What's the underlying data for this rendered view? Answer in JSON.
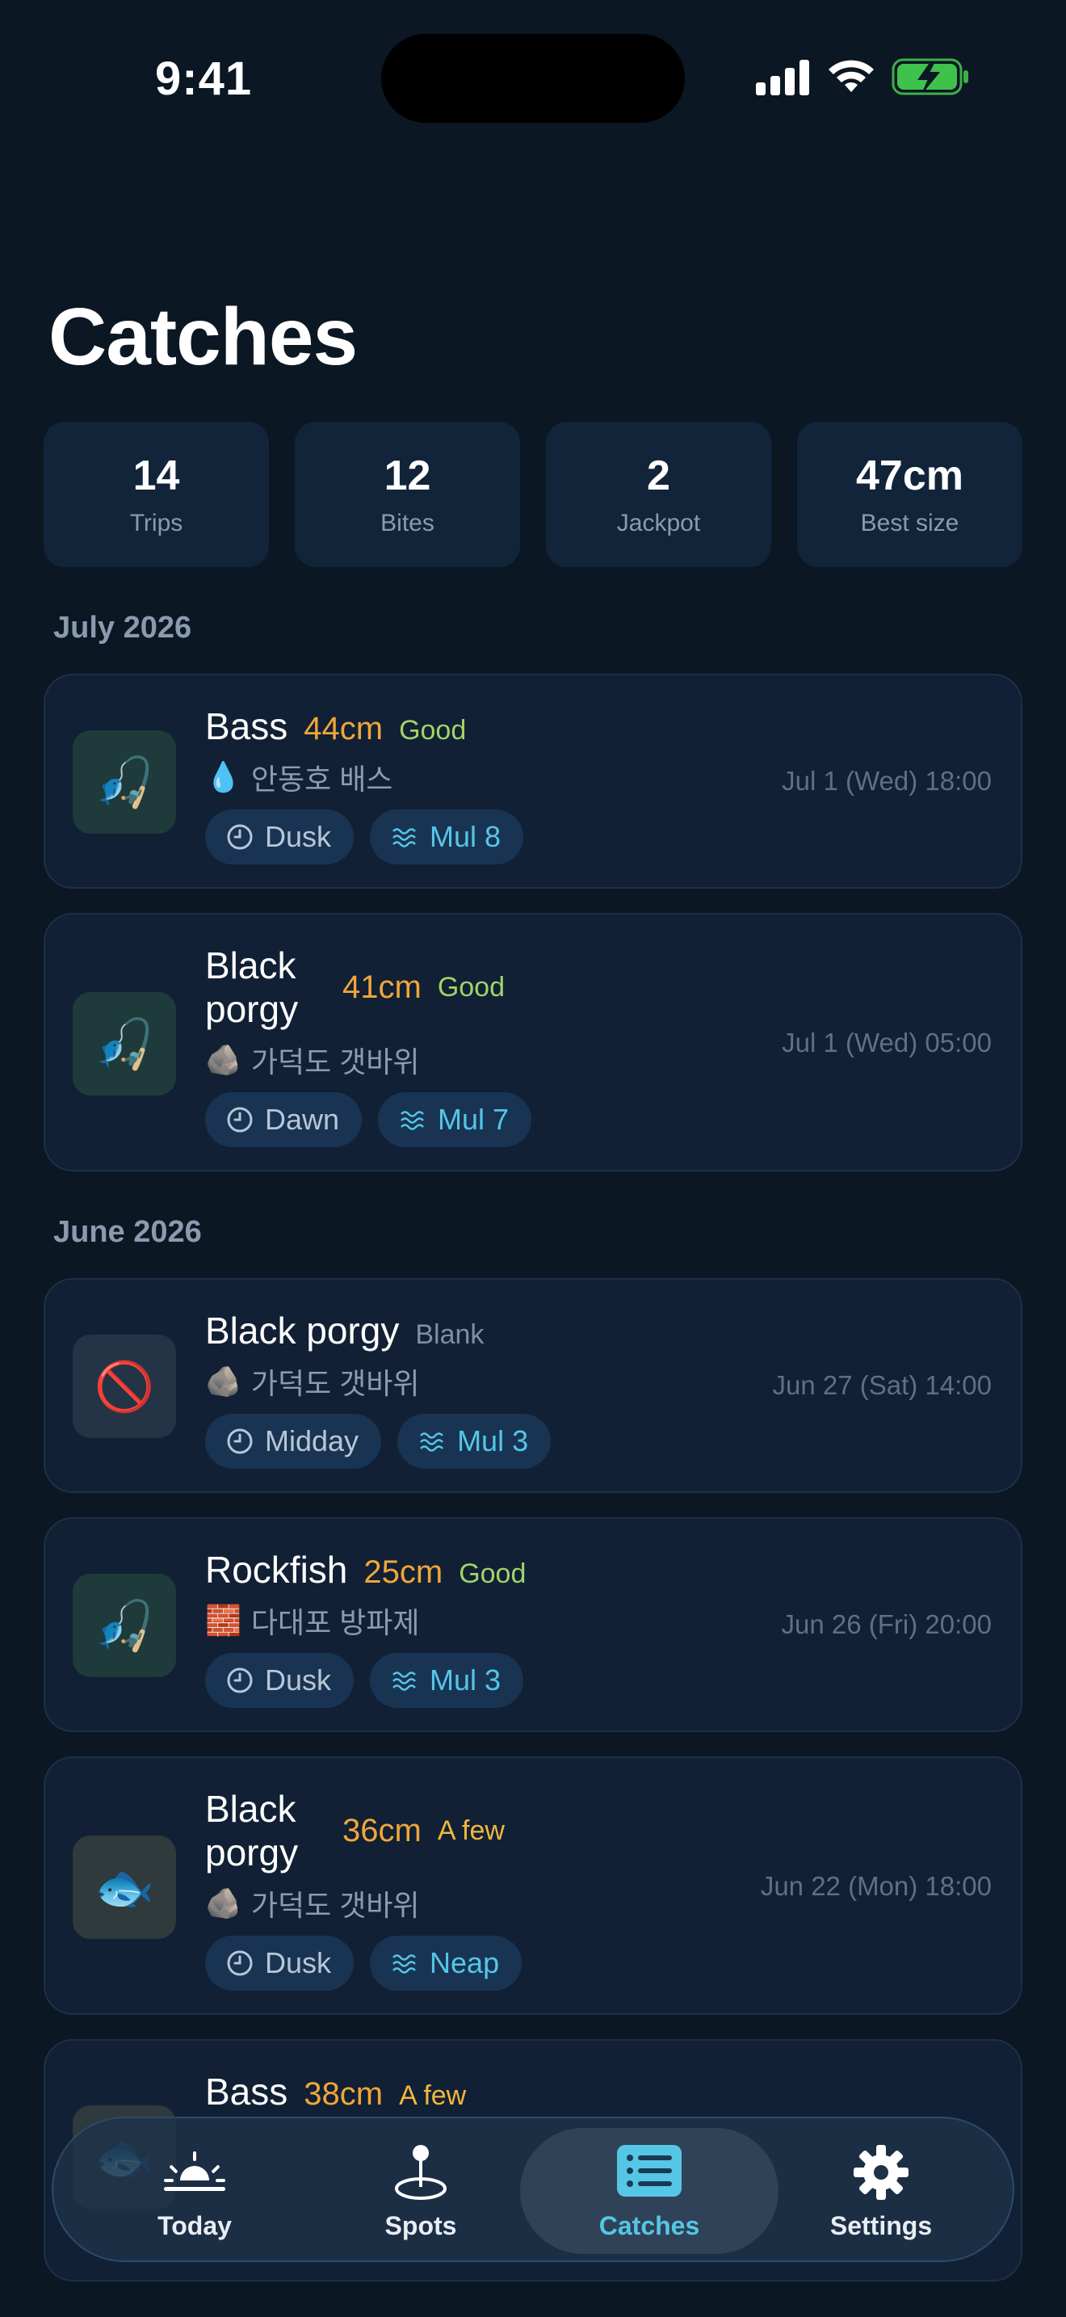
{
  "status_bar": {
    "time": "9:41"
  },
  "header": {
    "title": "Catches"
  },
  "stats": [
    {
      "value": "14",
      "label": "Trips"
    },
    {
      "value": "12",
      "label": "Bites"
    },
    {
      "value": "2",
      "label": "Jackpot"
    },
    {
      "value": "47cm",
      "label": "Best size"
    }
  ],
  "sections": [
    {
      "month": "July 2026",
      "catches": [
        {
          "species": "Bass",
          "size": "44cm",
          "rating": "Good",
          "place_icon": "💧",
          "place": "안동호 배스",
          "time_of_day": "Dusk",
          "tide": "Mul 8",
          "datetime": "Jul 1 (Wed) 18:00",
          "thumb": "🎣"
        },
        {
          "species": "Black porgy",
          "size": "41cm",
          "rating": "Good",
          "place_icon": "🪨",
          "place": "가덕도 갯바위",
          "time_of_day": "Dawn",
          "tide": "Mul 7",
          "datetime": "Jul 1 (Wed) 05:00",
          "thumb": "🎣"
        }
      ]
    },
    {
      "month": "June 2026",
      "catches": [
        {
          "species": "Black porgy",
          "size": "",
          "rating": "Blank",
          "place_icon": "🪨",
          "place": "가덕도 갯바위",
          "time_of_day": "Midday",
          "tide": "Mul 3",
          "datetime": "Jun 27 (Sat) 14:00",
          "thumb": "🚫"
        },
        {
          "species": "Rockfish",
          "size": "25cm",
          "rating": "Good",
          "place_icon": "🧱",
          "place": "다대포 방파제",
          "time_of_day": "Dusk",
          "tide": "Mul 3",
          "datetime": "Jun 26 (Fri) 20:00",
          "thumb": "🎣"
        },
        {
          "species": "Black porgy",
          "size": "36cm",
          "rating": "A few",
          "place_icon": "🪨",
          "place": "가덕도 갯바위",
          "time_of_day": "Dusk",
          "tide": "Neap",
          "datetime": "Jun 22 (Mon) 18:00",
          "thumb": "🐟"
        },
        {
          "species": "Bass",
          "size": "38cm",
          "rating": "A few",
          "thumb": "🐟"
        }
      ]
    }
  ],
  "tabbar": [
    {
      "label": "Today",
      "icon": "sunrise-icon"
    },
    {
      "label": "Spots",
      "icon": "map-pin-icon"
    },
    {
      "label": "Catches",
      "icon": "list-icon",
      "active": true
    },
    {
      "label": "Settings",
      "icon": "gear-icon"
    }
  ],
  "colors": {
    "background": "#0b1722",
    "card": "#112034",
    "accent": "#55c6e6",
    "size": "#f0a63a",
    "good": "#9fd36a",
    "few": "#f2b73d"
  }
}
